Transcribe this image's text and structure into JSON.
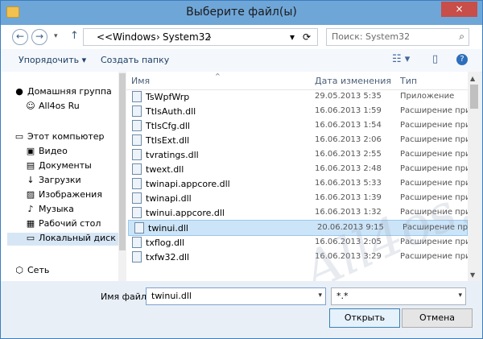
{
  "window": {
    "title": "Выберите файл(ы)",
    "close_icon": "×"
  },
  "nav": {
    "back_icon": "←",
    "forward_icon": "→",
    "history_icon": "▾",
    "up_icon": "↑",
    "path": [
      "<<",
      "Windows",
      "›",
      "System32",
      "›"
    ],
    "refresh_icon": "⟳",
    "dropdown_icon": "▾",
    "search_placeholder": "Поиск: System32",
    "search_icon": "⌕"
  },
  "toolbar": {
    "organize": "Упорядочить ▾",
    "new_folder": "Создать папку",
    "view_icon": "☷ ▾",
    "preview_icon": "▯",
    "help_icon": "?"
  },
  "sidebar": [
    {
      "icon": "●",
      "label": "Домашняя группа"
    },
    {
      "icon": "☺",
      "label": "All4os Ru"
    },
    {
      "icon": "▭",
      "label": "Этот компьютер"
    },
    {
      "icon": "▣",
      "label": "Видео"
    },
    {
      "icon": "▤",
      "label": "Документы"
    },
    {
      "icon": "↓",
      "label": "Загрузки"
    },
    {
      "icon": "▨",
      "label": "Изображения"
    },
    {
      "icon": "♪",
      "label": "Музыка"
    },
    {
      "icon": "▦",
      "label": "Рабочий стол"
    },
    {
      "icon": "▭",
      "label": "Локальный диск"
    },
    {
      "icon": "⬡",
      "label": "Сеть"
    }
  ],
  "columns": {
    "name": "Имя",
    "date": "Дата изменения",
    "type": "Тип",
    "sort_icon": "^"
  },
  "files": [
    {
      "name": "TsWpfWrp",
      "date": "29.05.2013 5:35",
      "type": "Приложение"
    },
    {
      "name": "TtlsAuth.dll",
      "date": "16.06.2013 1:59",
      "type": "Расширение при"
    },
    {
      "name": "TtlsCfg.dll",
      "date": "16.06.2013 1:54",
      "type": "Расширение при"
    },
    {
      "name": "TtlsExt.dll",
      "date": "16.06.2013 2:06",
      "type": "Расширение при"
    },
    {
      "name": "tvratings.dll",
      "date": "16.06.2013 2:55",
      "type": "Расширение при"
    },
    {
      "name": "twext.dll",
      "date": "16.06.2013 2:48",
      "type": "Расширение при"
    },
    {
      "name": "twinapi.appcore.dll",
      "date": "16.06.2013 5:33",
      "type": "Расширение при"
    },
    {
      "name": "twinapi.dll",
      "date": "16.06.2013 1:39",
      "type": "Расширение при"
    },
    {
      "name": "twinui.appcore.dll",
      "date": "16.06.2013 1:32",
      "type": "Расширение при"
    },
    {
      "name": "twinui.dll",
      "date": "20.06.2013 9:15",
      "type": "Расширение при"
    },
    {
      "name": "txflog.dll",
      "date": "16.06.2013 2:05",
      "type": "Расширение при"
    },
    {
      "name": "txfw32.dll",
      "date": "16.06.2013 3:29",
      "type": "Расширение при"
    }
  ],
  "scroll": {
    "up_icon": "▲",
    "down_icon": "▼"
  },
  "bottom": {
    "file_name_label": "Имя файла:",
    "file_name_value": "twinui.dll",
    "filter_value": "*.*",
    "dropdown_icon": "▾",
    "open_button": "Открыть",
    "cancel_button": "Отмена"
  },
  "watermark": "All4os.RU"
}
